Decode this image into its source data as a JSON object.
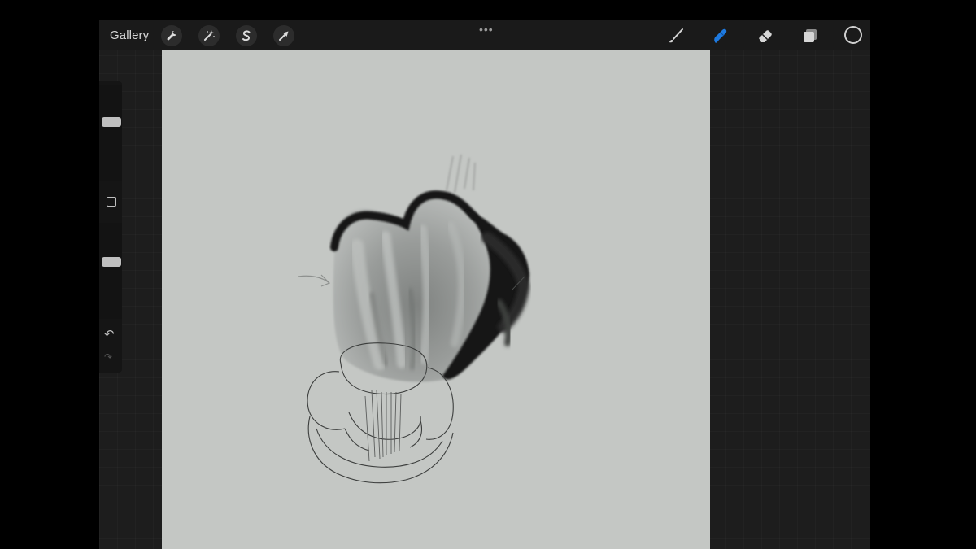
{
  "topbar": {
    "gallery_label": "Gallery",
    "left_tools": [
      {
        "name": "actions",
        "icon": "wrench-icon"
      },
      {
        "name": "adjustments",
        "icon": "magic-wand-icon"
      },
      {
        "name": "selection",
        "icon": "selection-s-icon"
      },
      {
        "name": "transform",
        "icon": "arrow-cursor-icon"
      }
    ],
    "grabber": "•••",
    "right_tools": [
      {
        "name": "brush",
        "icon": "brush-icon",
        "active": false
      },
      {
        "name": "smudge",
        "icon": "smudge-finger-icon",
        "active": true
      },
      {
        "name": "eraser",
        "icon": "eraser-icon",
        "active": false
      },
      {
        "name": "layers",
        "icon": "layers-icon",
        "active": false
      }
    ],
    "active_color": "#1a1a1a",
    "accent_color": "#1e7ae0"
  },
  "sidebar": {
    "brush_size_level": 0.55,
    "opacity_level": 0.6,
    "modify_icon": "square-icon",
    "undo_icon": "undo-arrow-icon",
    "redo_icon": "redo-arrow-icon"
  },
  "canvas": {
    "background_color": "#c4c7c4",
    "content": "sketch"
  }
}
